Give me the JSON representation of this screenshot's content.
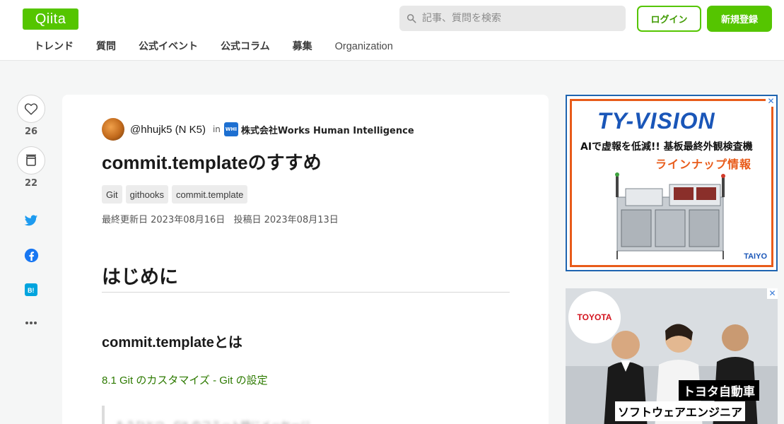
{
  "header": {
    "logo": "Qiita",
    "search_placeholder": "記事、質問を検索",
    "login_label": "ログイン",
    "signup_label": "新規登録",
    "nav": [
      "トレンド",
      "質問",
      "公式イベント",
      "公式コラム",
      "募集",
      "Organization"
    ]
  },
  "rail": {
    "like_count": "26",
    "stock_count": "22",
    "icons": [
      "heart-icon",
      "stock-icon",
      "twitter-icon",
      "facebook-icon",
      "hatena-bookmark-icon",
      "more-icon"
    ]
  },
  "article": {
    "author": "@hhujk5 (N K5)",
    "in_label": "in",
    "org_icon_text": "WHI",
    "organization": "株式会社Works Human Intelligence",
    "title": "commit.templateのすすめ",
    "tags": [
      "Git",
      "githooks",
      "commit.template"
    ],
    "updated": "最終更新日 2023年08月16日",
    "posted": "投稿日 2023年08月13日",
    "heading1": "はじめに",
    "heading2": "commit.templateとは",
    "link_text": "8.1 Git のカスタマイズ - Git の設定",
    "quote_preview": "もうひとつ、Git のコミット時にメッセージ"
  },
  "ads": {
    "ad1": {
      "brand": "TY-VISION",
      "line1": "AIで虚報を低減!! 基板最終外観検査機",
      "line2": "ラインナップ情報",
      "maker": "TAIYO"
    },
    "ad2": {
      "logo": "TOYOTA",
      "caption1": "トヨタ自動車",
      "caption2": "ソフトウェアエンジニア"
    },
    "close_glyph": "✕"
  },
  "colors": {
    "brand_green": "#55c500",
    "link_green": "#2d7a00",
    "ad_blue": "#1f64b0",
    "ad_orange": "#e85b1a"
  }
}
